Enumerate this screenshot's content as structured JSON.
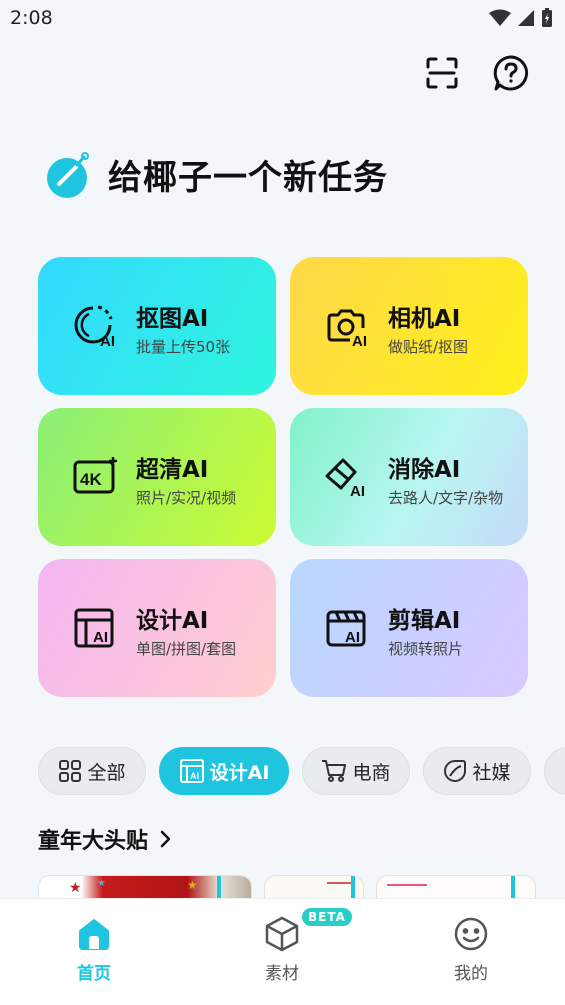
{
  "status": {
    "time": "2:08"
  },
  "hero": {
    "title": "给椰子一个新任务"
  },
  "tools": [
    {
      "title": "抠图AI",
      "sub": "批量上传50张",
      "icon": "cutout-ai-icon"
    },
    {
      "title": "相机AI",
      "sub": "做贴纸/抠图",
      "icon": "camera-ai-icon"
    },
    {
      "title": "超清AI",
      "sub": "照片/实况/视频",
      "icon": "4k-enhance-icon"
    },
    {
      "title": "消除AI",
      "sub": "去路人/文字/杂物",
      "icon": "eraser-ai-icon"
    },
    {
      "title": "设计AI",
      "sub": "单图/拼图/套图",
      "icon": "design-layout-icon"
    },
    {
      "title": "剪辑AI",
      "sub": "视频转照片",
      "icon": "clapperboard-icon"
    }
  ],
  "categories": [
    {
      "label": "全部",
      "icon": "grid-icon",
      "active": false
    },
    {
      "label": "设计AI",
      "icon": "design-layout-icon",
      "active": true
    },
    {
      "label": "电商",
      "icon": "cart-icon",
      "active": false
    },
    {
      "label": "社媒",
      "icon": "social-icon",
      "active": false
    }
  ],
  "section": {
    "title": "童年大头贴"
  },
  "tabs": [
    {
      "label": "首页",
      "icon": "home-icon",
      "active": true
    },
    {
      "label": "素材",
      "icon": "cube-icon",
      "active": false,
      "badge": "BETA"
    },
    {
      "label": "我的",
      "icon": "smile-face-icon",
      "active": false
    }
  ],
  "colors": {
    "accent": "#1fc5df",
    "beta": "#27cfc6"
  }
}
